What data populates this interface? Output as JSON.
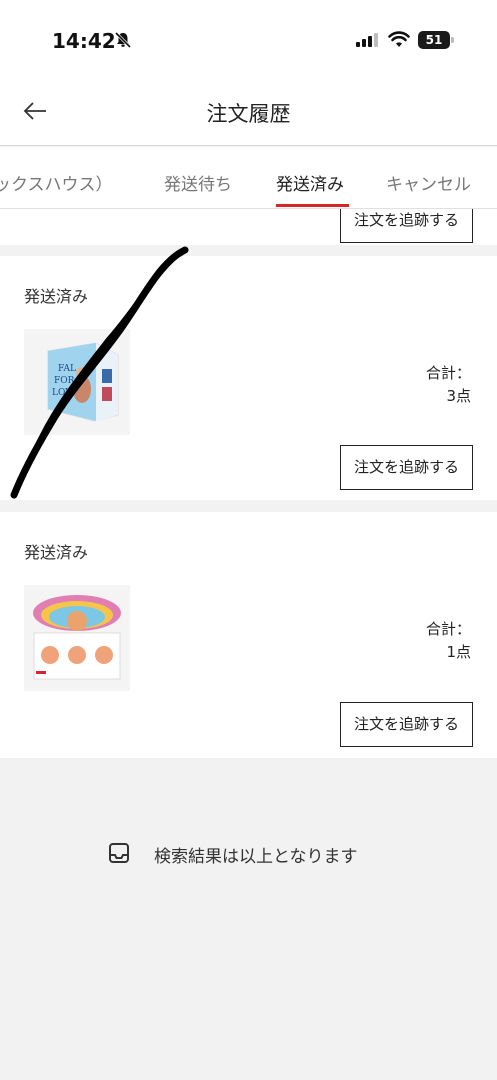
{
  "status_bar": {
    "time": "14:42",
    "battery": "51"
  },
  "header": {
    "title": "注文履歴"
  },
  "tabs": [
    {
      "label": "ックスハウス）",
      "active": false
    },
    {
      "label": "発送待ち",
      "active": false
    },
    {
      "label": "発送済み",
      "active": true
    },
    {
      "label": "キャンセル",
      "active": false
    }
  ],
  "accent_color": "#d7262b",
  "orders": [
    {
      "button": "注文を追跡する"
    },
    {
      "status": "発送済み",
      "total_label": "合計：",
      "total_count": "3点",
      "button": "注文を追跡する"
    },
    {
      "status": "発送済み",
      "total_label": "合計：",
      "total_count": "1点",
      "button": "注文を追跡する"
    }
  ],
  "end_message": "検索結果は以上となります"
}
